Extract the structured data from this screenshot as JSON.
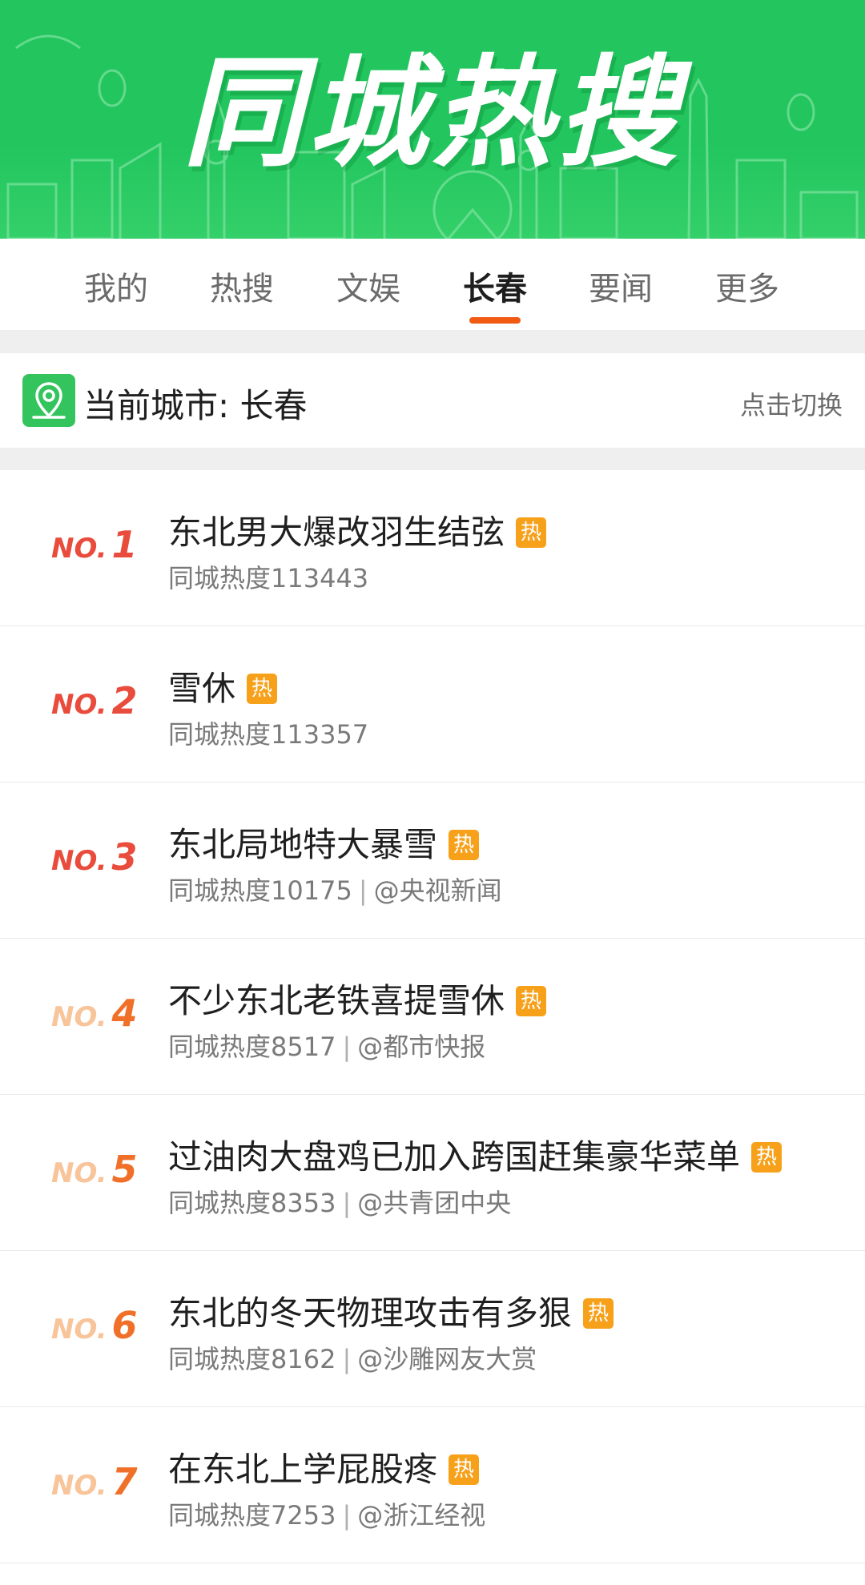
{
  "banner": {
    "title": "同城热搜"
  },
  "tabs": [
    {
      "label": "我的",
      "active": false
    },
    {
      "label": "热搜",
      "active": false
    },
    {
      "label": "文娱",
      "active": false
    },
    {
      "label": "长春",
      "active": true
    },
    {
      "label": "要闻",
      "active": false
    },
    {
      "label": "更多",
      "active": false
    }
  ],
  "city": {
    "label": "当前城市: 长春",
    "switch_label": "点击切换",
    "icon": "location-pin-icon"
  },
  "colors": {
    "accent": "#f05a12",
    "brand_green": "#22c55e",
    "hot_badge": "#f7a11b",
    "rank_top": "#e94b3c",
    "rank_mid": "#f0702a",
    "rank_low": "#f5a04d"
  },
  "list": [
    {
      "rank_prefix": "NO.",
      "rank": "1",
      "title": "东北男大爆改羽生结弦",
      "badge": "热",
      "heat": "同城热度113443",
      "source": ""
    },
    {
      "rank_prefix": "NO.",
      "rank": "2",
      "title": "雪休",
      "badge": "热",
      "heat": "同城热度113357",
      "source": ""
    },
    {
      "rank_prefix": "NO.",
      "rank": "3",
      "title": "东北局地特大暴雪",
      "badge": "热",
      "heat": "同城热度10175",
      "source": "@央视新闻"
    },
    {
      "rank_prefix": "NO.",
      "rank": "4",
      "title": "不少东北老铁喜提雪休",
      "badge": "热",
      "heat": "同城热度8517",
      "source": "@都市快报"
    },
    {
      "rank_prefix": "NO.",
      "rank": "5",
      "title": "过油肉大盘鸡已加入跨国赶集豪华菜单",
      "badge": "热",
      "heat": "同城热度8353",
      "source": "@共青团中央"
    },
    {
      "rank_prefix": "NO.",
      "rank": "6",
      "title": "东北的冬天物理攻击有多狠",
      "badge": "热",
      "heat": "同城热度8162",
      "source": "@沙雕网友大赏"
    },
    {
      "rank_prefix": "NO.",
      "rank": "7",
      "title": "在东北上学屁股疼",
      "badge": "热",
      "heat": "同城热度7253",
      "source": "@浙江经视"
    }
  ]
}
